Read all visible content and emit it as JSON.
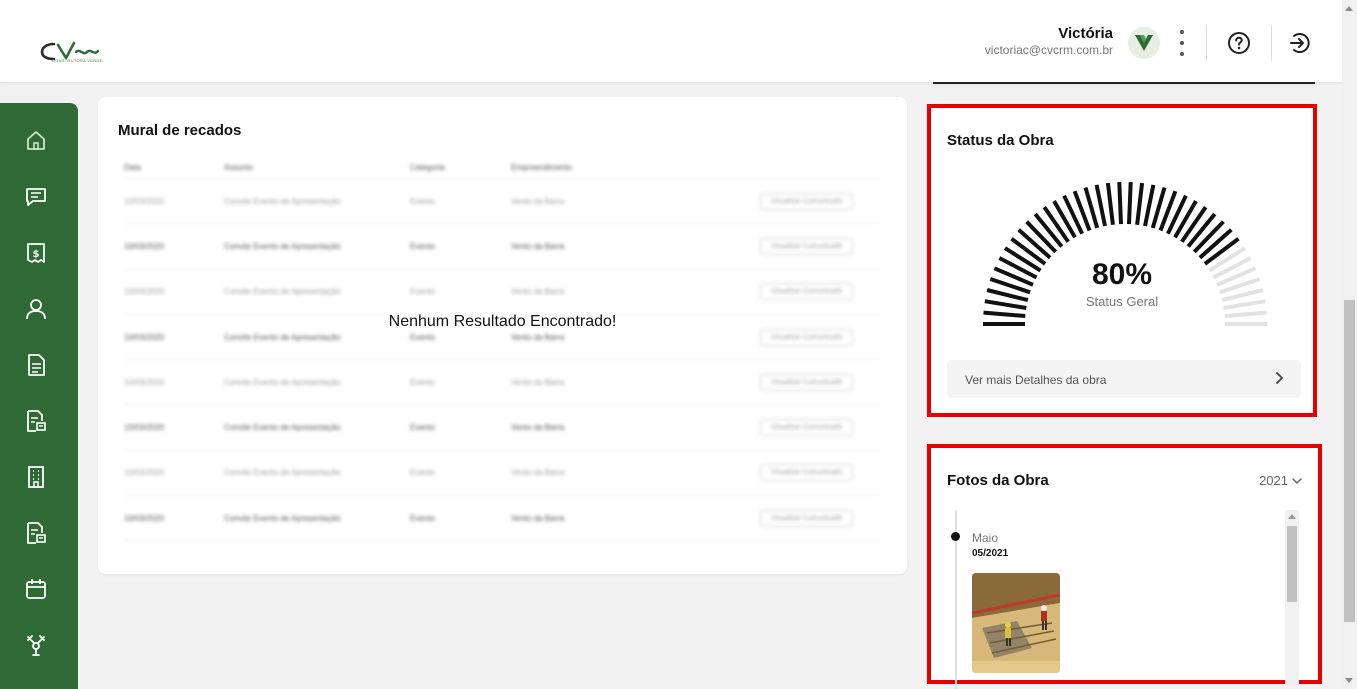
{
  "header": {
    "logo_text": "CVC",
    "logo_subtitle": "CONSTRUTORA VERDE",
    "user_name": "Victória",
    "user_email": "victoriac@cvcrm.com.br",
    "avatar_letter": "V"
  },
  "sidebar": {
    "items": [
      "home-icon",
      "messages-icon",
      "finance-icon",
      "user-icon",
      "document-icon",
      "document-search-icon",
      "building-icon",
      "document-search-icon",
      "calendar-icon",
      "tools-icon"
    ]
  },
  "mural": {
    "title": "Mural de recados",
    "empty_message": "Nenhum Resultado Encontrado!",
    "columns": [
      "Data",
      "Assunto",
      "Categoria",
      "Empreendimento"
    ],
    "rows": [
      {
        "data": "10/03/2020",
        "assunto": "Convite Evento de Apresentação",
        "categoria": "Evento",
        "empreendimento": "Vento da Barra",
        "acao": "Visualizar Comunicado"
      },
      {
        "data": "10/03/2020",
        "assunto": "Convite Evento de Apresentação",
        "categoria": "Evento",
        "empreendimento": "Vento da Barra",
        "acao": "Visualizar Comunicado"
      },
      {
        "data": "10/03/2020",
        "assunto": "Convite Evento de Apresentação",
        "categoria": "Evento",
        "empreendimento": "Vento da Barra",
        "acao": "Visualizar Comunicado"
      },
      {
        "data": "10/03/2020",
        "assunto": "Convite Evento de Apresentação",
        "categoria": "Evento",
        "empreendimento": "Vento da Barra",
        "acao": "Visualizar Comunicado"
      },
      {
        "data": "10/03/2020",
        "assunto": "Convite Evento de Apresentação",
        "categoria": "Evento",
        "empreendimento": "Vento da Barra",
        "acao": "Visualizar Comunicado"
      },
      {
        "data": "10/03/2020",
        "assunto": "Convite Evento de Apresentação",
        "categoria": "Evento",
        "empreendimento": "Vento da Barra",
        "acao": "Visualizar Comunicado"
      },
      {
        "data": "10/03/2020",
        "assunto": "Convite Evento de Apresentação",
        "categoria": "Evento",
        "empreendimento": "Vento da Barra",
        "acao": "Visualizar Comunicado"
      },
      {
        "data": "10/03/2020",
        "assunto": "Convite Evento de Apresentação",
        "categoria": "Evento",
        "empreendimento": "Vento da Barra",
        "acao": "Visualizar Comunicado"
      }
    ]
  },
  "status": {
    "title": "Status da Obra",
    "percent_value": 80,
    "percent_label": "80%",
    "sub_label": "Status Geral",
    "details_label": "Ver mais Detalhes da obra",
    "active_color": "#111111",
    "inactive_color": "#e2e2e2"
  },
  "fotos": {
    "title": "Fotos da Obra",
    "year": "2021",
    "entries": [
      {
        "month": "Maio",
        "date": "05/2021"
      }
    ]
  },
  "colors": {
    "sidebar": "#2f6a36",
    "highlight": "#e60000"
  }
}
